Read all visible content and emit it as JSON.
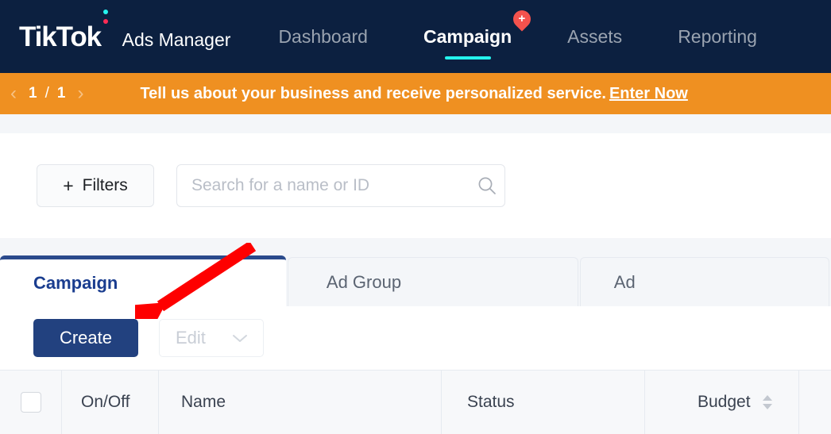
{
  "header": {
    "brand_primary": "TikTok",
    "brand_secondary": "Ads Manager",
    "nav": [
      {
        "label": "Dashboard",
        "active": false,
        "badge": ""
      },
      {
        "label": "Campaign",
        "active": true,
        "badge": "+"
      },
      {
        "label": "Assets",
        "active": false,
        "badge": ""
      },
      {
        "label": "Reporting",
        "active": false,
        "badge": ""
      }
    ],
    "colors": {
      "background": "#0c2040",
      "active_underline": "#25f4ee",
      "badge": "#f4524d",
      "brand_dot_cyan": "#25f4ee",
      "brand_dot_pink": "#fe2c55"
    }
  },
  "banner": {
    "prev_arrow": "‹",
    "current_page": "1",
    "separator": "/",
    "total_pages": "1",
    "next_arrow": "›",
    "message": "Tell us about your business and receive personalized service.",
    "link_label": "Enter Now",
    "background": "#ef9021"
  },
  "toolbar": {
    "filters_label": "Filters",
    "filters_plus": "+",
    "search_value": "",
    "search_placeholder": "Search for a name or ID",
    "search_icon": "search-icon"
  },
  "tabs": [
    {
      "label": "Campaign",
      "active": true
    },
    {
      "label": "Ad Group",
      "active": false
    },
    {
      "label": "Ad",
      "active": false
    }
  ],
  "actions": {
    "create_label": "Create",
    "edit_label": "Edit",
    "edit_disabled": true,
    "edit_chevron": "chevron-down-icon",
    "create_color": "#22417f"
  },
  "table": {
    "select_all_checked": false,
    "columns": [
      {
        "label": "On/Off",
        "sortable": false
      },
      {
        "label": "Name",
        "sortable": false
      },
      {
        "label": "Status",
        "sortable": false
      },
      {
        "label": "Budget",
        "sortable": true
      }
    ]
  },
  "annotation": {
    "type": "arrow",
    "color": "#fe0000",
    "points_to": "create-button"
  }
}
